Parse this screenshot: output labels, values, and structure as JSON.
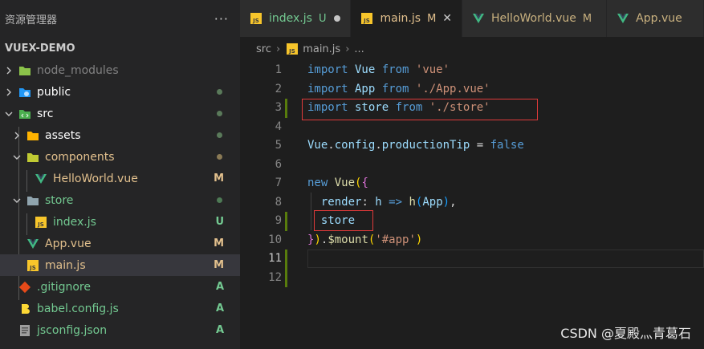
{
  "sidebar": {
    "title": "资源管理器",
    "more": "···",
    "project": "VUEX-DEMO",
    "items": [
      {
        "label": "node_modules",
        "status": "",
        "dot": false
      },
      {
        "label": "public",
        "status": "",
        "dot": true
      },
      {
        "label": "src",
        "status": "",
        "dot": true
      },
      {
        "label": "assets",
        "status": "",
        "dot": true
      },
      {
        "label": "components",
        "status": "",
        "dot": true
      },
      {
        "label": "HelloWorld.vue",
        "status": "M",
        "dot": false
      },
      {
        "label": "store",
        "status": "",
        "dot": true
      },
      {
        "label": "index.js",
        "status": "U",
        "dot": false
      },
      {
        "label": "App.vue",
        "status": "M",
        "dot": false
      },
      {
        "label": "main.js",
        "status": "M",
        "dot": false
      },
      {
        "label": ".gitignore",
        "status": "A",
        "dot": false
      },
      {
        "label": "babel.config.js",
        "status": "A",
        "dot": false
      },
      {
        "label": "jsconfig.json",
        "status": "A",
        "dot": false
      }
    ]
  },
  "tabs": [
    {
      "label": "index.js",
      "status": "U"
    },
    {
      "label": "main.js",
      "status": "M",
      "close": "✕"
    },
    {
      "label": "HelloWorld.vue",
      "status": "M"
    },
    {
      "label": "App.vue",
      "status": ""
    }
  ],
  "breadcrumb": {
    "root": "src",
    "file": "main.js",
    "more": "..."
  },
  "editor": {
    "line_numbers": [
      "1",
      "2",
      "3",
      "4",
      "5",
      "6",
      "7",
      "8",
      "9",
      "10",
      "11",
      "12"
    ],
    "lines": [
      [
        {
          "t": "import",
          "c": "kw"
        },
        {
          "t": " Vue ",
          "c": "id"
        },
        {
          "t": "from",
          "c": "kw"
        },
        {
          "t": " ",
          "c": "op"
        },
        {
          "t": "'vue'",
          "c": "str"
        }
      ],
      [
        {
          "t": "import",
          "c": "kw"
        },
        {
          "t": " App ",
          "c": "id"
        },
        {
          "t": "from",
          "c": "kw"
        },
        {
          "t": " ",
          "c": "op"
        },
        {
          "t": "'./App.vue'",
          "c": "str"
        }
      ],
      [
        {
          "t": "import",
          "c": "kw"
        },
        {
          "t": " store ",
          "c": "id"
        },
        {
          "t": "from",
          "c": "kw"
        },
        {
          "t": " ",
          "c": "op"
        },
        {
          "t": "'./store'",
          "c": "str"
        }
      ],
      [],
      [
        {
          "t": "Vue",
          "c": "id"
        },
        {
          "t": ".",
          "c": "op"
        },
        {
          "t": "config",
          "c": "id"
        },
        {
          "t": ".",
          "c": "op"
        },
        {
          "t": "productionTip",
          "c": "id"
        },
        {
          "t": " = ",
          "c": "op"
        },
        {
          "t": "false",
          "c": "kw"
        }
      ],
      [],
      [
        {
          "t": "new",
          "c": "kw"
        },
        {
          "t": " ",
          "c": "op"
        },
        {
          "t": "Vue",
          "c": "fn"
        },
        {
          "t": "(",
          "c": "br1"
        },
        {
          "t": "{",
          "c": "br2"
        }
      ],
      [
        {
          "t": "  render",
          "c": "id"
        },
        {
          "t": ": ",
          "c": "op"
        },
        {
          "t": "h",
          "c": "id"
        },
        {
          "t": " ",
          "c": "op"
        },
        {
          "t": "=>",
          "c": "kw"
        },
        {
          "t": " ",
          "c": "op"
        },
        {
          "t": "h",
          "c": "fn"
        },
        {
          "t": "(",
          "c": "br3"
        },
        {
          "t": "App",
          "c": "id"
        },
        {
          "t": ")",
          "c": "br3"
        },
        {
          "t": ",",
          "c": "op"
        }
      ],
      [
        {
          "t": "  store",
          "c": "id"
        }
      ],
      [
        {
          "t": "}",
          "c": "br2"
        },
        {
          "t": ")",
          "c": "br1"
        },
        {
          "t": ".",
          "c": "op"
        },
        {
          "t": "$mount",
          "c": "fn"
        },
        {
          "t": "(",
          "c": "br1"
        },
        {
          "t": "'#app'",
          "c": "str"
        },
        {
          "t": ")",
          "c": "br1"
        }
      ],
      [],
      []
    ]
  },
  "watermark": "CSDN @夏殿灬青葛石",
  "colors": {
    "accent": "#569cd6",
    "string": "#ce9178",
    "highlight_box": "#e03a3a",
    "modified_badge": "#e2c08d",
    "untracked_badge": "#73c991"
  }
}
